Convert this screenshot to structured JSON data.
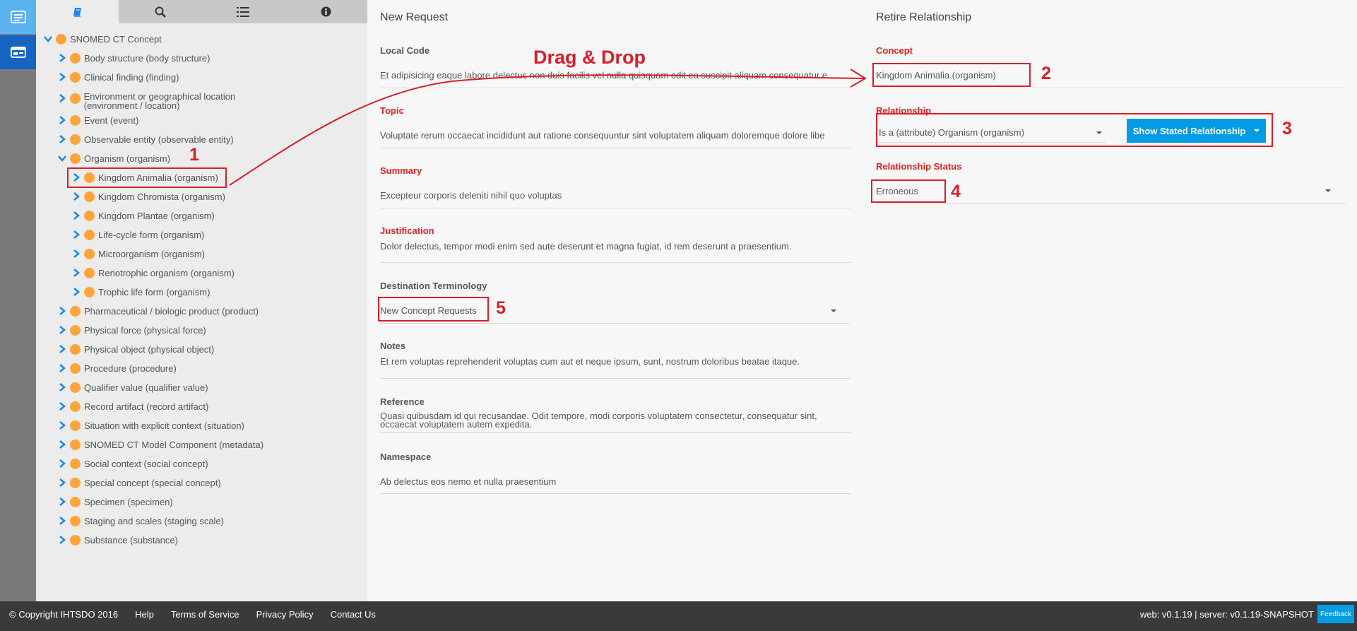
{
  "nav": {
    "rail_icons": [
      "list-view-icon",
      "card-view-icon"
    ],
    "tabs": [
      {
        "name": "taxonomy-tab",
        "icon": "book-icon",
        "active": true
      },
      {
        "name": "search-tab",
        "icon": "search-icon",
        "active": false
      },
      {
        "name": "list-tab",
        "icon": "numbered-list-icon",
        "active": false
      },
      {
        "name": "info-tab",
        "icon": "info-icon",
        "active": false
      }
    ]
  },
  "tree": {
    "root": "SNOMED CT Concept",
    "items": [
      "Body structure (body structure)",
      "Clinical finding (finding)",
      "Environment or geographical location (environment / location)",
      "Event (event)",
      "Observable entity (observable entity)",
      "Organism (organism)",
      "Kingdom Animalia (organism)",
      "Kingdom Chromista (organism)",
      "Kingdom Plantae (organism)",
      "Life-cycle form (organism)",
      "Microorganism (organism)",
      "Renotrophic organism (organism)",
      "Trophic life form (organism)",
      "Pharmaceutical / biologic product (product)",
      "Physical force (physical force)",
      "Physical object (physical object)",
      "Procedure (procedure)",
      "Qualifier value (qualifier value)",
      "Record artifact (record artifact)",
      "Situation with explicit context (situation)",
      "SNOMED CT Model Component (metadata)",
      "Social context (social concept)",
      "Special concept (special concept)",
      "Specimen (specimen)",
      "Staging and scales (staging scale)",
      "Substance (substance)"
    ]
  },
  "request": {
    "title": "New Request",
    "local_code_label": "Local Code",
    "local_code_value": "Et adipisicing eaque labore delectus non duis facilis vel nulla quisquam odit ea suscipit aliquam consequatur e",
    "topic_label": "Topic",
    "topic_value": "Voluptate rerum occaecat incididunt aut ratione consequuntur sint voluptatem aliquam doloremque dolore libe",
    "summary_label": "Summary",
    "summary_value": "Excepteur corporis deleniti nihil quo voluptas",
    "justification_label": "Justification",
    "justification_value": "Dolor delectus, tempor modi enim sed aute deserunt et magna fugiat, id rem deserunt a praesentium.",
    "destination_label": "Destination Terminology",
    "destination_value": "New Concept Requests",
    "notes_label": "Notes",
    "notes_value": "Et rem voluptas reprehenderit voluptas cum aut et neque ipsum, sunt, nostrum doloribus beatae itaque.",
    "reference_label": "Reference",
    "reference_value": "Quasi quibusdam id qui recusandae. Odit tempore, modi corporis voluptatem consectetur, consequatur sint, occaecat voluptatem autem expedita.",
    "namespace_label": "Namespace",
    "namespace_value": "Ab delectus eos nemo et nulla praesentium"
  },
  "retire": {
    "title": "Retire Relationship",
    "concept_label": "Concept",
    "concept_value": "Kingdom Animalia (organism)",
    "relationship_label": "Relationship",
    "relationship_value": "Is a (attribute) Organism (organism)",
    "show_stated_button": "Show Stated Relationship",
    "status_label": "Relationship Status",
    "status_value": "Erroneous"
  },
  "annotations": {
    "drag_drop": "Drag & Drop",
    "n1": "1",
    "n2": "2",
    "n3": "3",
    "n4": "4",
    "n5": "5",
    "color": "#d91e2a"
  },
  "footer": {
    "copyright": "© Copyright IHTSDO 2016",
    "help": "Help",
    "terms": "Terms of Service",
    "privacy": "Privacy Policy",
    "contact": "Contact Us",
    "versions": "web: v0.1.19 | server: v0.1.19-SNAPSHOT",
    "feedback": "Feedback"
  },
  "colors": {
    "accent_blue": "#039be5",
    "concept_dot": "#ffa43a",
    "required_label": "#e02020"
  }
}
